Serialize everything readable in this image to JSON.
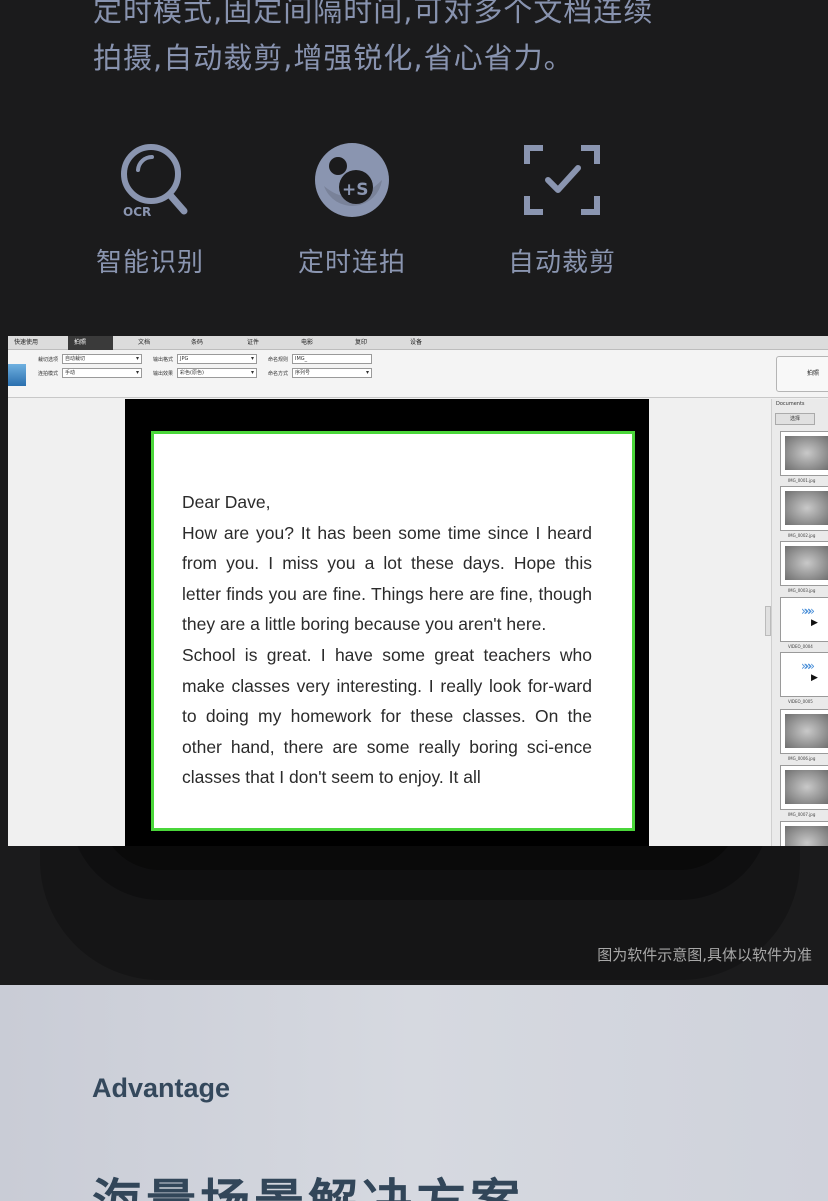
{
  "intro": {
    "line1": "定时模式,固定间隔时间,可对多个文档连续",
    "line2": "拍摄,自动裁剪,增强锐化,省心省力。"
  },
  "features": [
    {
      "label": "智能识别",
      "icon": "ocr-magnifier-icon",
      "icon_text": "OCR"
    },
    {
      "label": "定时连拍",
      "icon": "timed-shooting-icon",
      "icon_text": "+S"
    },
    {
      "label": "自动裁剪",
      "icon": "auto-crop-icon"
    }
  ],
  "app": {
    "menu": [
      "快速使用",
      "拍照",
      "文档",
      "条码",
      "证件",
      "电影",
      "复印",
      "设备"
    ],
    "active_menu": "拍照",
    "toolbar": {
      "crop_label": "裁切选项",
      "crop_value": "自动裁切",
      "shoot_label": "连拍模式",
      "shoot_value": "手动",
      "output_label": "输出格式",
      "output_value": "JPG",
      "effect_label": "输出效果",
      "effect_value": "彩色(原色)",
      "name_label": "命名规则",
      "name_value": "IMG_",
      "naming_label": "命名方式",
      "naming_value": "序列号",
      "capture_label": "拍照"
    },
    "panel": {
      "title": "Documents",
      "tab": "选择"
    },
    "thumbs": [
      "IMG_0001.jpg",
      "IMG_0002.jpg",
      "IMG_0003.jpg",
      "VIDEO_0004",
      "VIDEO_0005",
      "IMG_0006.jpg",
      "IMG_0007.jpg"
    ],
    "letter": [
      "Dear Dave,",
      "How are you? It has been some time since I heard from you. I miss you a lot these days. Hope this letter finds you are fine. Things here are fine, though they are a little boring because you aren't here.",
      "School is great. I have some great teachers who make classes very interesting. I really look for-ward to doing my homework for these classes. On the other hand, there are some really boring sci-ence classes that I don't seem to enjoy. It all"
    ]
  },
  "note": "图为软件示意图,具体以软件为准",
  "advantage": {
    "eyebrow": "Advantage",
    "heading": "海量场景解决方案"
  },
  "colors": {
    "dark_bg": "#1b1b1c",
    "icon": "#8a95b0",
    "doc_border": "#4ad63a",
    "light_bg": "#d2d5dd",
    "heading": "#324659"
  }
}
